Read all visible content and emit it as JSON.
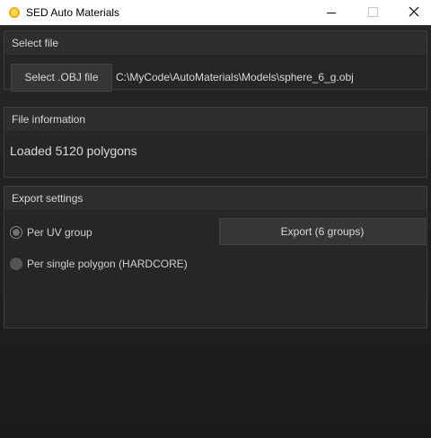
{
  "window": {
    "title": "SED Auto Materials"
  },
  "icons": {
    "app": "sun-icon",
    "minimize": "minimize-icon",
    "maximize": "maximize-icon",
    "close": "close-icon"
  },
  "select_file": {
    "header": "Select file",
    "button_label": "Select .OBJ file",
    "path": "C:\\MyCode\\AutoMaterials\\Models\\sphere_6_g.obj"
  },
  "file_info": {
    "header": "File information",
    "status": "Loaded 5120 polygons"
  },
  "export_settings": {
    "header": "Export settings",
    "options": [
      {
        "label": "Per UV group",
        "selected": true,
        "enabled": true
      },
      {
        "label": "Per single polygon (HARDCORE)",
        "selected": false,
        "enabled": false
      }
    ],
    "export_button": "Export (6 groups)"
  },
  "colors": {
    "background": "#1d1d1d",
    "panel": "#262626",
    "button": "#363636",
    "text": "#d8d8d8"
  }
}
